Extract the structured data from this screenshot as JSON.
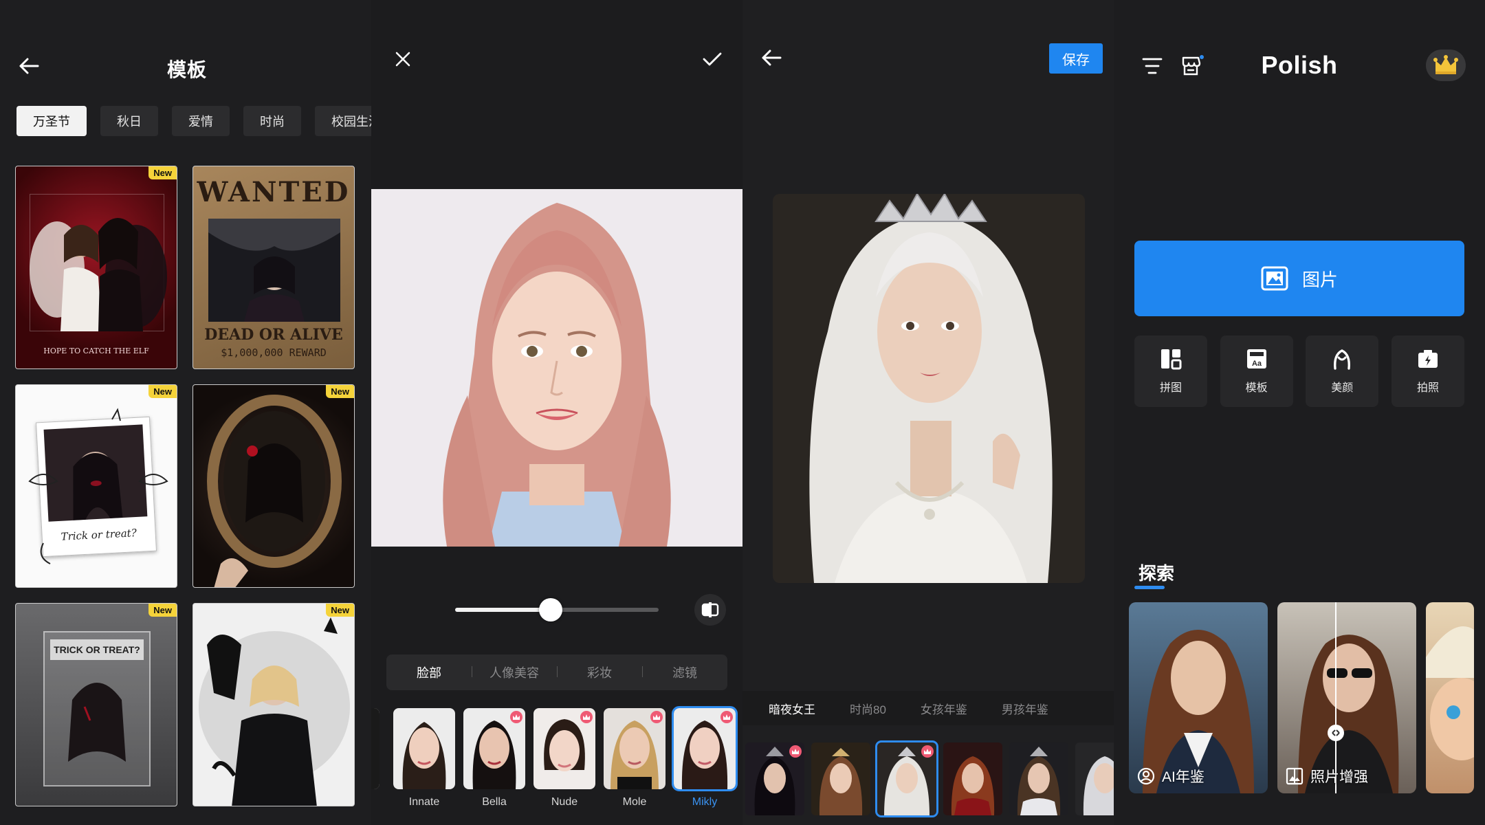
{
  "template_panel": {
    "title": "模板",
    "chips": [
      "万圣节",
      "秋日",
      "爱情",
      "时尚",
      "校园生活"
    ],
    "new_badge": "New",
    "cards": [
      {
        "text": "HOPE TO CATCH THE ELF",
        "new": true
      },
      {
        "text_top": "WANTED",
        "text_bottom": "DEAD OR ALIVE",
        "reward": "$1,000,000 REWARD",
        "new": false
      },
      {
        "text": "Trick or treat?",
        "new": true
      },
      {
        "text": "",
        "new": true
      },
      {
        "text": "TRICK OR TREAT?",
        "new": true
      },
      {
        "text": "",
        "new": true
      }
    ]
  },
  "beauty_panel": {
    "slider_value": 0.47,
    "segments": [
      "脸部",
      "人像美容",
      "彩妆",
      "滤镜"
    ],
    "active_segment": 0,
    "presets": [
      {
        "label": "Innate",
        "premium": false
      },
      {
        "label": "Bella",
        "premium": true
      },
      {
        "label": "Nude",
        "premium": true
      },
      {
        "label": "Mole",
        "premium": true
      },
      {
        "label": "Mikly",
        "premium": true
      }
    ],
    "selected_preset": 4
  },
  "style_panel": {
    "save_label": "保存",
    "tabs": [
      "暗夜女王",
      "时尚80",
      "女孩年鉴",
      "男孩年鉴"
    ],
    "active_tab": 0,
    "thumb_count": 6,
    "selected_thumb": 2
  },
  "home_panel": {
    "brand": "Polish",
    "primary_label": "图片",
    "tools": [
      {
        "label": "拼图",
        "icon": "collage-icon"
      },
      {
        "label": "模板",
        "icon": "template-icon"
      },
      {
        "label": "美颜",
        "icon": "beauty-icon"
      },
      {
        "label": "拍照",
        "icon": "camera-icon"
      }
    ],
    "explore_title": "探索",
    "explore_cards": [
      {
        "label": "AI年鉴"
      },
      {
        "label": "照片增强"
      }
    ]
  }
}
